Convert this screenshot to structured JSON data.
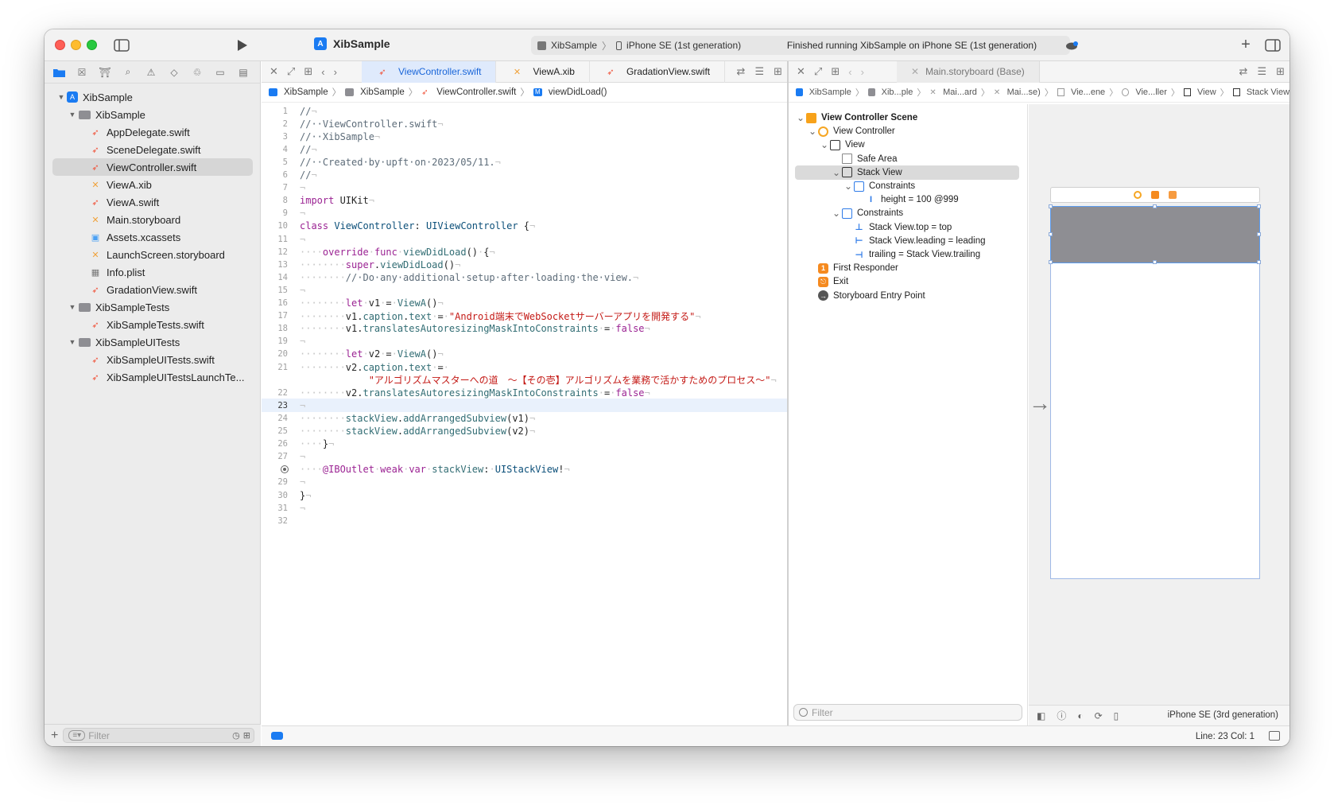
{
  "toolbar": {
    "project_name": "XibSample",
    "scheme": "XibSample",
    "destination": "iPhone SE (1st generation)",
    "status": "Finished running XibSample on iPhone SE (1st generation)",
    "add_icon": "plus-icon",
    "run_icon": "play-icon"
  },
  "navigator": {
    "tree": [
      {
        "label": "XibSample",
        "kind": "project",
        "depth": 0,
        "expanded": true
      },
      {
        "label": "XibSample",
        "kind": "folder",
        "depth": 1,
        "expanded": true
      },
      {
        "label": "AppDelegate.swift",
        "kind": "swift",
        "depth": 2
      },
      {
        "label": "SceneDelegate.swift",
        "kind": "swift",
        "depth": 2
      },
      {
        "label": "ViewController.swift",
        "kind": "swift",
        "depth": 2,
        "selected": true
      },
      {
        "label": "ViewA.xib",
        "kind": "xib",
        "depth": 2
      },
      {
        "label": "ViewA.swift",
        "kind": "swift",
        "depth": 2
      },
      {
        "label": "Main.storyboard",
        "kind": "xib",
        "depth": 2
      },
      {
        "label": "Assets.xcassets",
        "kind": "assets",
        "depth": 2
      },
      {
        "label": "LaunchScreen.storyboard",
        "kind": "xib",
        "depth": 2
      },
      {
        "label": "Info.plist",
        "kind": "plist",
        "depth": 2
      },
      {
        "label": "GradationView.swift",
        "kind": "swift",
        "depth": 2
      },
      {
        "label": "XibSampleTests",
        "kind": "folder",
        "depth": 1,
        "expanded": true
      },
      {
        "label": "XibSampleTests.swift",
        "kind": "swift",
        "depth": 2
      },
      {
        "label": "XibSampleUITests",
        "kind": "folder",
        "depth": 1,
        "expanded": true
      },
      {
        "label": "XibSampleUITests.swift",
        "kind": "swift",
        "depth": 2
      },
      {
        "label": "XibSampleUITestsLaunchTe...",
        "kind": "swift",
        "depth": 2
      }
    ],
    "filter_placeholder": "Filter"
  },
  "editor": {
    "tabs": [
      {
        "label": "ViewController.swift",
        "kind": "swift",
        "active": true
      },
      {
        "label": "ViewA.xib",
        "kind": "xib",
        "active": false
      },
      {
        "label": "GradationView.swift",
        "kind": "swift",
        "active": false
      }
    ],
    "jumpbar": [
      "XibSample",
      "XibSample",
      "ViewController.swift",
      "viewDidLoad()"
    ],
    "current_line": 23,
    "lines": [
      {
        "n": "1",
        "tokens": [
          [
            "c",
            "//"
          ],
          [
            "w",
            "¬"
          ]
        ]
      },
      {
        "n": "2",
        "tokens": [
          [
            "c",
            "//··ViewController.swift"
          ],
          [
            "w",
            "¬"
          ]
        ]
      },
      {
        "n": "3",
        "tokens": [
          [
            "c",
            "//··XibSample"
          ],
          [
            "w",
            "¬"
          ]
        ]
      },
      {
        "n": "4",
        "tokens": [
          [
            "c",
            "//"
          ],
          [
            "w",
            "¬"
          ]
        ]
      },
      {
        "n": "5",
        "tokens": [
          [
            "c",
            "//··Created·by·upft·on·2023/05/11."
          ],
          [
            "w",
            "¬"
          ]
        ]
      },
      {
        "n": "6",
        "tokens": [
          [
            "c",
            "//"
          ],
          [
            "w",
            "¬"
          ]
        ]
      },
      {
        "n": "7",
        "tokens": [
          [
            "w",
            "¬"
          ]
        ]
      },
      {
        "n": "8",
        "tokens": [
          [
            "k",
            "import"
          ],
          [
            "p",
            " UIKit"
          ],
          [
            "w",
            "¬"
          ]
        ]
      },
      {
        "n": "9",
        "tokens": [
          [
            "w",
            "¬"
          ]
        ]
      },
      {
        "n": "10",
        "tokens": [
          [
            "k",
            "class"
          ],
          [
            "p",
            " "
          ],
          [
            "t",
            "ViewController"
          ],
          [
            "p",
            ": "
          ],
          [
            "t",
            "UIViewController"
          ],
          [
            "p",
            " {"
          ],
          [
            "w",
            "¬"
          ]
        ]
      },
      {
        "n": "11",
        "tokens": [
          [
            "w",
            "¬"
          ]
        ]
      },
      {
        "n": "12",
        "tokens": [
          [
            "w",
            "····"
          ],
          [
            "k",
            "override"
          ],
          [
            "w",
            "·"
          ],
          [
            "k",
            "func"
          ],
          [
            "w",
            "·"
          ],
          [
            "f",
            "viewDidLoad"
          ],
          [
            "p",
            "()"
          ],
          [
            "w",
            "·"
          ],
          [
            "p",
            "{"
          ],
          [
            "w",
            "¬"
          ]
        ]
      },
      {
        "n": "13",
        "tokens": [
          [
            "w",
            "········"
          ],
          [
            "k",
            "super"
          ],
          [
            "p",
            "."
          ],
          [
            "f",
            "viewDidLoad"
          ],
          [
            "p",
            "()"
          ],
          [
            "w",
            "¬"
          ]
        ]
      },
      {
        "n": "14",
        "tokens": [
          [
            "w",
            "········"
          ],
          [
            "c",
            "//·Do·any·additional·setup·after·loading·the·view."
          ],
          [
            "w",
            "¬"
          ]
        ]
      },
      {
        "n": "15",
        "tokens": [
          [
            "w",
            "¬"
          ]
        ]
      },
      {
        "n": "16",
        "tokens": [
          [
            "w",
            "········"
          ],
          [
            "k",
            "let"
          ],
          [
            "w",
            "·"
          ],
          [
            "p",
            "v1"
          ],
          [
            "w",
            "·"
          ],
          [
            "p",
            "="
          ],
          [
            "w",
            "·"
          ],
          [
            "f",
            "ViewA"
          ],
          [
            "p",
            "()"
          ],
          [
            "w",
            "¬"
          ]
        ]
      },
      {
        "n": "17",
        "tokens": [
          [
            "w",
            "········"
          ],
          [
            "p",
            "v1."
          ],
          [
            "f",
            "caption"
          ],
          [
            "p",
            "."
          ],
          [
            "f",
            "text"
          ],
          [
            "w",
            "·"
          ],
          [
            "p",
            "="
          ],
          [
            "w",
            "·"
          ],
          [
            "s",
            "\"Android端末でWebSocketサーバーアプリを開発する\""
          ],
          [
            "w",
            "¬"
          ]
        ]
      },
      {
        "n": "18",
        "tokens": [
          [
            "w",
            "········"
          ],
          [
            "p",
            "v1."
          ],
          [
            "f",
            "translatesAutoresizingMaskIntoConstraints"
          ],
          [
            "w",
            "·"
          ],
          [
            "p",
            "="
          ],
          [
            "w",
            "·"
          ],
          [
            "k",
            "false"
          ],
          [
            "w",
            "¬"
          ]
        ]
      },
      {
        "n": "19",
        "tokens": [
          [
            "w",
            "¬"
          ]
        ]
      },
      {
        "n": "20",
        "tokens": [
          [
            "w",
            "········"
          ],
          [
            "k",
            "let"
          ],
          [
            "w",
            "·"
          ],
          [
            "p",
            "v2"
          ],
          [
            "w",
            "·"
          ],
          [
            "p",
            "="
          ],
          [
            "w",
            "·"
          ],
          [
            "f",
            "ViewA"
          ],
          [
            "p",
            "()"
          ],
          [
            "w",
            "¬"
          ]
        ]
      },
      {
        "n": "21",
        "tokens": [
          [
            "w",
            "········"
          ],
          [
            "p",
            "v2."
          ],
          [
            "f",
            "caption"
          ],
          [
            "p",
            "."
          ],
          [
            "f",
            "text"
          ],
          [
            "w",
            "·"
          ],
          [
            "p",
            "="
          ],
          [
            "w",
            "·"
          ]
        ]
      },
      {
        "n": "",
        "tokens": [
          [
            "p",
            "            "
          ],
          [
            "s",
            "\"アルゴリズムマスターへの道　〜【その壱】アルゴリズムを業務で活かすためのプロセス〜\""
          ],
          [
            "w",
            "¬"
          ]
        ]
      },
      {
        "n": "22",
        "tokens": [
          [
            "w",
            "········"
          ],
          [
            "p",
            "v2."
          ],
          [
            "f",
            "translatesAutoresizingMaskIntoConstraints"
          ],
          [
            "w",
            "·"
          ],
          [
            "p",
            "="
          ],
          [
            "w",
            "·"
          ],
          [
            "k",
            "false"
          ],
          [
            "w",
            "¬"
          ]
        ]
      },
      {
        "n": "23",
        "tokens": [
          [
            "w",
            "¬"
          ]
        ]
      },
      {
        "n": "24",
        "tokens": [
          [
            "w",
            "········"
          ],
          [
            "f",
            "stackView"
          ],
          [
            "p",
            "."
          ],
          [
            "f",
            "addArrangedSubview"
          ],
          [
            "p",
            "(v1)"
          ],
          [
            "w",
            "¬"
          ]
        ]
      },
      {
        "n": "25",
        "tokens": [
          [
            "w",
            "········"
          ],
          [
            "f",
            "stackView"
          ],
          [
            "p",
            "."
          ],
          [
            "f",
            "addArrangedSubview"
          ],
          [
            "p",
            "(v2)"
          ],
          [
            "w",
            "¬"
          ]
        ]
      },
      {
        "n": "26",
        "tokens": [
          [
            "w",
            "····"
          ],
          [
            "p",
            "}"
          ],
          [
            "w",
            "¬"
          ]
        ]
      },
      {
        "n": "27",
        "tokens": [
          [
            "w",
            "¬"
          ]
        ]
      },
      {
        "n": "28",
        "outlet": true,
        "tokens": [
          [
            "w",
            "····"
          ],
          [
            "k",
            "@IBOutlet"
          ],
          [
            "w",
            "·"
          ],
          [
            "k",
            "weak"
          ],
          [
            "w",
            "·"
          ],
          [
            "k",
            "var"
          ],
          [
            "w",
            "·"
          ],
          [
            "f",
            "stackView"
          ],
          [
            "p",
            ":"
          ],
          [
            "w",
            "·"
          ],
          [
            "t",
            "UIStackView"
          ],
          [
            "p",
            "!"
          ],
          [
            "w",
            "¬"
          ]
        ]
      },
      {
        "n": "29",
        "tokens": [
          [
            "w",
            "¬"
          ]
        ]
      },
      {
        "n": "30",
        "tokens": [
          [
            "p",
            "}"
          ],
          [
            "w",
            "¬"
          ]
        ]
      },
      {
        "n": "31",
        "tokens": [
          [
            "w",
            "¬"
          ]
        ]
      },
      {
        "n": "32",
        "tokens": []
      }
    ]
  },
  "ib": {
    "tab": "Main.storyboard (Base)",
    "jumpbar": [
      "XibSample",
      "Xib...ple",
      "Mai...ard",
      "Mai...se)",
      "Vie...ene",
      "Vie...ller",
      "View",
      "Stack View"
    ],
    "outline": [
      {
        "label": "View Controller Scene",
        "icon": "scene",
        "depth": 0,
        "disc": "v",
        "bold": true
      },
      {
        "label": "View Controller",
        "icon": "vc",
        "depth": 1,
        "disc": "v"
      },
      {
        "label": "View",
        "icon": "view",
        "depth": 2,
        "disc": "v"
      },
      {
        "label": "Safe Area",
        "icon": "safe",
        "depth": 3,
        "disc": ""
      },
      {
        "label": "Stack View",
        "icon": "view",
        "depth": 3,
        "disc": "v",
        "selected": true
      },
      {
        "label": "Constraints",
        "icon": "cons",
        "depth": 4,
        "disc": "v"
      },
      {
        "label": "height = 100 @999",
        "icon": "cv-height",
        "depth": 5,
        "disc": ""
      },
      {
        "label": "Constraints",
        "icon": "cons",
        "depth": 3,
        "disc": "v"
      },
      {
        "label": "Stack View.top = top",
        "icon": "cv-top",
        "depth": 4,
        "disc": ""
      },
      {
        "label": "Stack View.leading = leading",
        "icon": "cv-leading",
        "depth": 4,
        "disc": ""
      },
      {
        "label": "trailing = Stack View.trailing",
        "icon": "cv-trailing",
        "depth": 4,
        "disc": ""
      },
      {
        "label": "First Responder",
        "icon": "first",
        "depth": 1,
        "disc": ""
      },
      {
        "label": "Exit",
        "icon": "exit",
        "depth": 1,
        "disc": ""
      },
      {
        "label": "Storyboard Entry Point",
        "icon": "entry",
        "depth": 1,
        "disc": ""
      }
    ],
    "filter_placeholder": "Filter",
    "canvas_device": "iPhone SE (3rd generation)"
  },
  "statusbar": {
    "line_col": "Line: 23  Col: 1"
  }
}
